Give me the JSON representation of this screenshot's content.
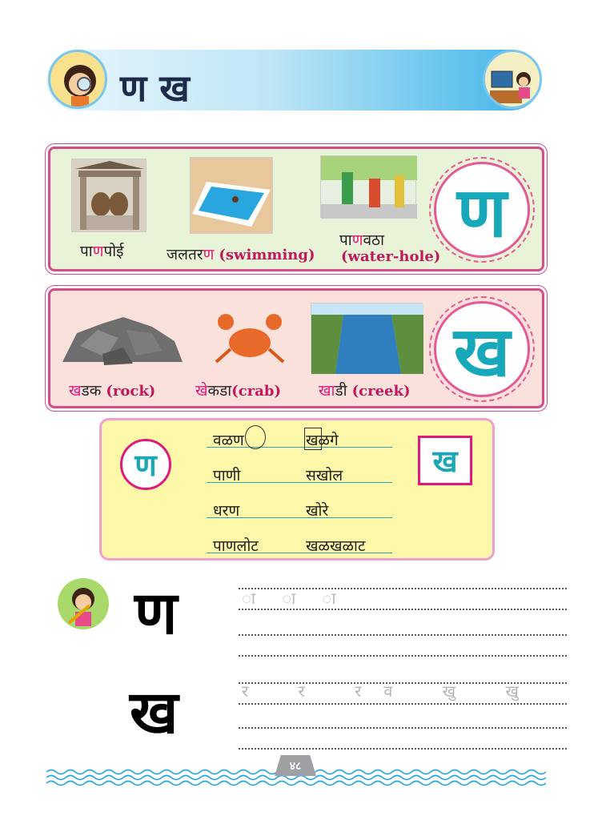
{
  "header": {
    "title": "ण ख"
  },
  "box_na": {
    "letter": "ण",
    "items": [
      {
        "pre": "पा",
        "hl": "ण",
        "post": "पोई",
        "en": ""
      },
      {
        "pre": "जलतर",
        "hl": "ण",
        "post": "",
        "en": "(swimming)"
      },
      {
        "pre": "पा",
        "hl": "ण",
        "post": "वठा",
        "en": "(water-hole)"
      }
    ]
  },
  "box_kha": {
    "letter": "ख",
    "items": [
      {
        "pre": "",
        "hl": "ख",
        "post": "डक",
        "en": "(rock)"
      },
      {
        "pre": "",
        "hl": "खे",
        "post": "कडा",
        "en": "(crab)"
      },
      {
        "pre": "",
        "hl": "खा",
        "post": "डी",
        "en": "(creek)"
      }
    ]
  },
  "practice": {
    "left_letter": "ण",
    "right_letter": "ख",
    "col1": [
      "वळण",
      "पाणी",
      "धरण",
      "पाणलोट"
    ],
    "col2": [
      "खळगे",
      "सखोल",
      "खोरे",
      "खळखळाट"
    ]
  },
  "writing": {
    "letter1": "ण",
    "letter2": "ख",
    "trace1": "ा ा ा",
    "trace2": "र र रव खु खु"
  },
  "page_number": "४८",
  "colors": {
    "accent": "#e2197a",
    "teal": "#17a8ba",
    "box_na_bg": "#e8f3d7",
    "box_kha_bg": "#fbe1dc"
  }
}
